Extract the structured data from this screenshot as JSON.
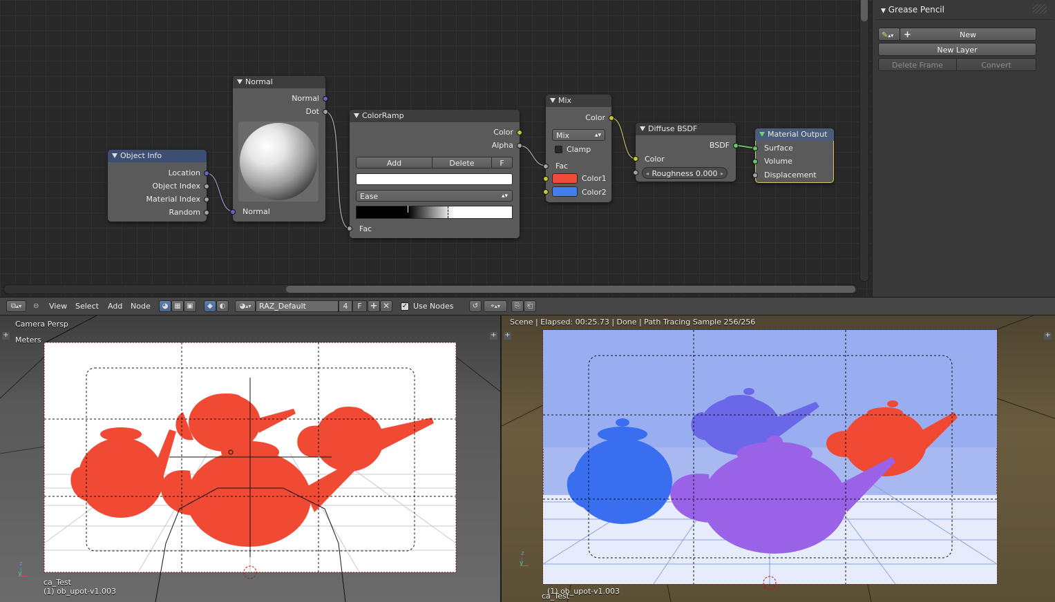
{
  "node_editor": {
    "nodes": {
      "object_info": {
        "title": "Object Info",
        "outputs": [
          "Location",
          "Object Index",
          "Material Index",
          "Random"
        ]
      },
      "normal": {
        "title": "Normal",
        "outputs": [
          "Normal",
          "Dot"
        ],
        "input": "Normal"
      },
      "colorramp": {
        "title": "ColorRamp",
        "outputs": [
          "Color",
          "Alpha"
        ],
        "add": "Add",
        "delete": "Delete",
        "flip": "F",
        "interpolation": "Ease",
        "input": "Fac"
      },
      "mix": {
        "title": "Mix",
        "output": "Color",
        "blend": "Mix",
        "clamp": "Clamp",
        "inputs": [
          "Fac",
          "Color1",
          "Color2"
        ],
        "color1": "#f04a3a",
        "color2": "#3f7ff0"
      },
      "diffuse": {
        "title": "Diffuse BSDF",
        "output": "BSDF",
        "input": "Color",
        "roughness": "Roughness 0.000"
      },
      "material_output": {
        "title": "Material Output",
        "inputs": [
          "Surface",
          "Volume",
          "Displacement"
        ]
      }
    }
  },
  "grease_pencil": {
    "title": "Grease Pencil",
    "new": "New",
    "new_layer": "New Layer",
    "delete_frame": "Delete Frame",
    "convert": "Convert"
  },
  "header": {
    "menus": [
      "View",
      "Select",
      "Add",
      "Node"
    ],
    "material_name": "RAZ_Default",
    "users": "4",
    "fake_user": "F",
    "use_nodes": "Use Nodes"
  },
  "viewport_left": {
    "view_name": "Camera Persp",
    "units": "Meters",
    "camera": "ca_Test",
    "object": "(1) ob_upot-v1.003",
    "teapot_color": "#f04a35"
  },
  "viewport_right": {
    "status": "Scene | Elapsed: 00:25.73 | Done | Path Tracing Sample 256/256",
    "object": "(1) ob_upot-v1.003",
    "camera": "ca_Test"
  }
}
